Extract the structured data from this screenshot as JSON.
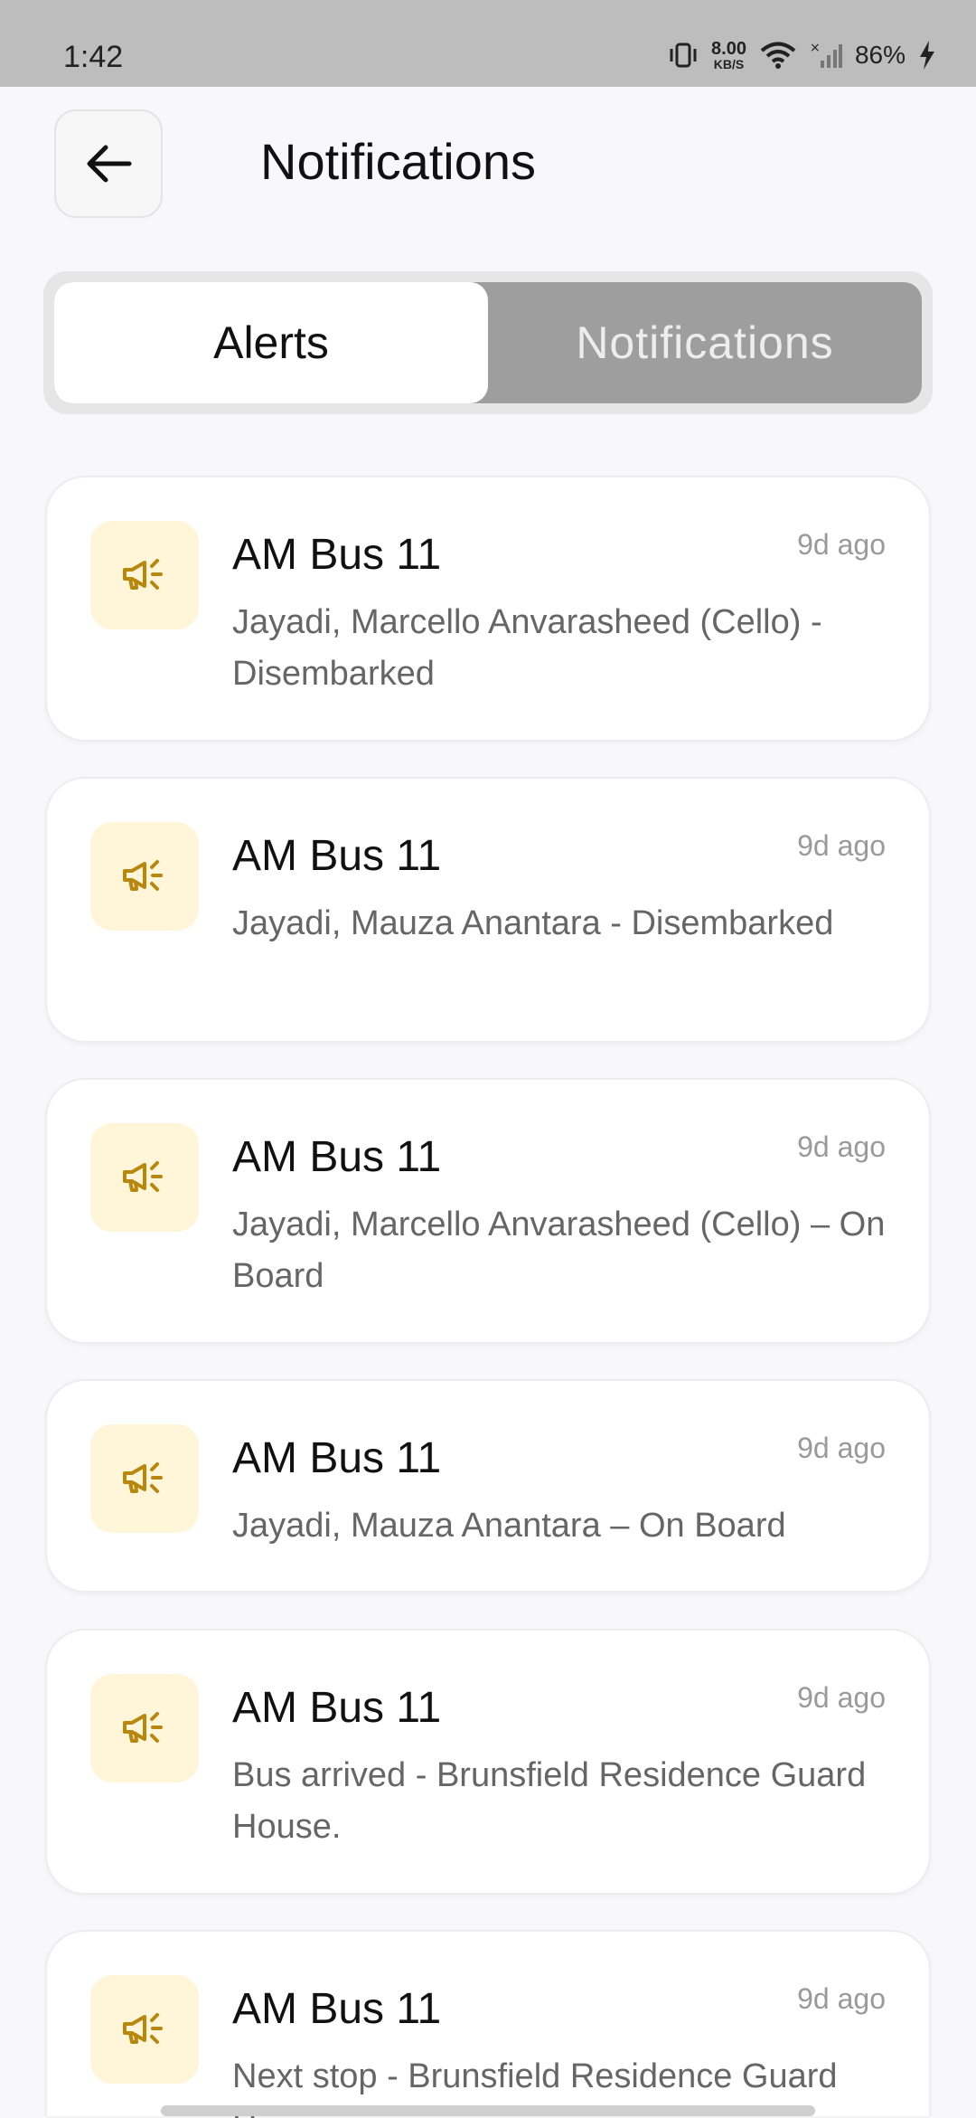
{
  "status_bar": {
    "time": "1:42",
    "speed_value": "8.00",
    "speed_unit": "KB/S",
    "battery": "86%"
  },
  "header": {
    "back_icon": "arrow-left-icon",
    "title": "Notifications"
  },
  "tabs": {
    "alerts": "Alerts",
    "notifications": "Notifications",
    "active": "alerts"
  },
  "notifications": [
    {
      "title": "AM Bus 11",
      "time": "9d ago",
      "message": "Jayadi, Marcello Anvarasheed (Cello) - Disembarked",
      "icon": "megaphone-icon"
    },
    {
      "title": "AM Bus 11",
      "time": "9d ago",
      "message": "Jayadi, Mauza Anantara - Disembarked",
      "icon": "megaphone-icon"
    },
    {
      "title": "AM Bus 11",
      "time": "9d ago",
      "message": "Jayadi, Marcello Anvarasheed (Cello) – On Board",
      "icon": "megaphone-icon"
    },
    {
      "title": "AM Bus 11",
      "time": "9d ago",
      "message": "Jayadi, Mauza Anantara – On Board",
      "icon": "megaphone-icon"
    },
    {
      "title": "AM Bus 11",
      "time": "9d ago",
      "message": "Bus arrived - Brunsfield Residence Guard House.",
      "icon": "megaphone-icon"
    },
    {
      "title": "AM Bus 11",
      "time": "9d ago",
      "message": "Next stop - Brunsfield Residence Guard House",
      "icon": "megaphone-icon"
    }
  ],
  "colors": {
    "icon_bg": "#fff5d9",
    "icon_fg": "#b8870e",
    "tab_inactive_bg": "#9e9e9e"
  }
}
